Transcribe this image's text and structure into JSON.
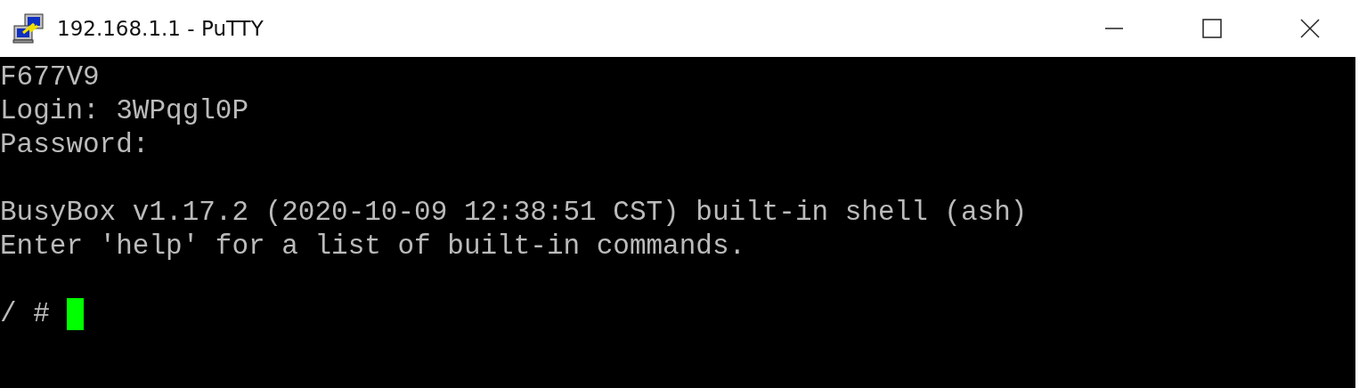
{
  "window": {
    "title": "192.168.1.1 - PuTTY"
  },
  "terminal": {
    "blocks": [
      [
        "F677V9",
        "Login: 3WPqgl0P",
        "Password:"
      ],
      [
        "BusyBox v1.17.2 (2020-10-09 12:38:51 CST) built-in shell (ash)",
        "Enter 'help' for a list of built-in commands."
      ]
    ],
    "prompt": "/ #",
    "cursor_visible": true
  }
}
